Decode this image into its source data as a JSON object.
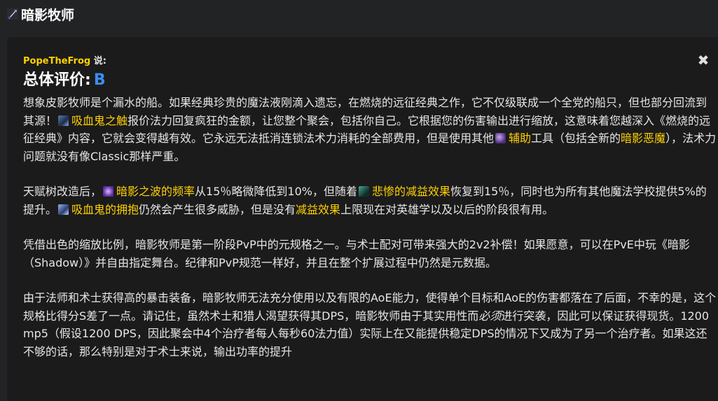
{
  "header": {
    "title": "暗影牧师",
    "icon": "shadow-priest-class-icon"
  },
  "review": {
    "author": "PopeTheFrog",
    "says": "说:",
    "rating_label": "总体评价:",
    "rating_grade": "B",
    "close_symbol": "✖"
  },
  "p1": {
    "t1": "想象皮影牧师是个漏水的船。如果经典珍贵的魔法液刚滴入遗忘，在燃烧的远征经典之作，它不仅级联成一个全党的船只，但也部分回流到其源！",
    "spell1": "吸血鬼之触",
    "t2": "报价法力回复疯狂的金额，让您整个聚会，包括你自己。它根据您的伤害输出进行缩放，这意味着您越深入《燃烧的远征经典》内容，它就会变得越有效。它永远无法抵消连锁法术力消耗的全部费用，但是使用其他",
    "spell2": "辅助",
    "t3": "工具（包括全新的",
    "spell3": "暗影恶魔",
    "t4": "），法术力问题就没有像Classic那样严重。"
  },
  "p2": {
    "t1": "天赋树改造后，",
    "spell1": "暗影之波的频率",
    "t2": "从15％略微降低到10%，但随着",
    "spell2": "悲惨的减益效果",
    "t3": "恢复到15％，同时也为所有其他魔法学校提供5%的提升。",
    "spell3": "吸血鬼的拥抱",
    "t4": "仍然会产生很多威胁，但是没有",
    "hl1": "减益效果",
    "t5": "上限现在对英雄学以及以后的阶段很有用。"
  },
  "p3": {
    "t1": "凭借出色的缩放比例，暗影牧师是第一阶段PvP中的元规格之一。与术士配对可带来强大的2v2补偿！如果愿意，可以在PvE中玩《暗影（Shadow）》并自由指定舞台。纪律和PvP规范一样好，并且在整个扩展过程中仍然是元数据。"
  },
  "p4": {
    "t1": "由于法师和术士获得高的暴击装备，暗影牧师无法充分使用以及有限的AoE能力，使得单个目标和AoE的伤害都落在了后面，不幸的是，这个规格比得分S差了一点。请记住，虽然术士和猎人渴望获得其DPS，暗影牧师由于其实用性而",
    "em1": "必须",
    "t2": "进行突袭，因此可以保证获得现货。1200 mp5（假设1200 DPS，因此聚会中4个治疗者每人每秒60法力值）实际上在又能提供稳定DPS的情况下又成为了另一个治疗者。如果这还不够的话，那么特别是对于术士来说，输出功率的提升"
  },
  "icons": {
    "vampiric_touch": "vampiric-touch-icon",
    "shadowfiend": "shadowfiend-icon",
    "shadow_weaving": "shadow-weaving-icon",
    "misery": "misery-icon",
    "vampiric_embrace": "vampiric-embrace-icon"
  },
  "colors": {
    "background": "#222324",
    "card": "#1b1b1c",
    "spell_link": "#ffd100",
    "grade": "#3b8cf0",
    "text": "#e6e6e6"
  }
}
